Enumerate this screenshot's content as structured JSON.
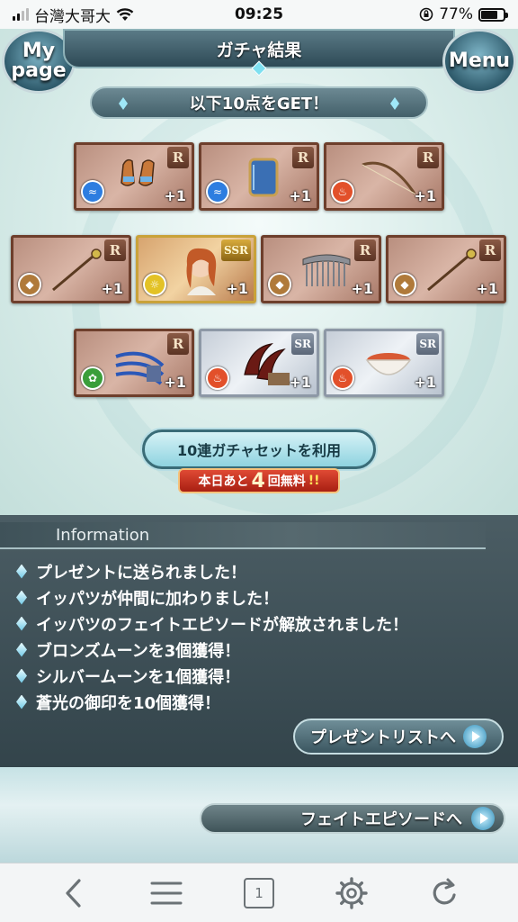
{
  "status": {
    "carrier": "台灣大哥大",
    "time": "09:25",
    "battery": "77%",
    "battery_level": 0.77
  },
  "header": {
    "title": "ガチャ結果",
    "mypage_label": "My page",
    "menu_label": "Menu"
  },
  "banner": {
    "text": "以下10点をGET！"
  },
  "items": [
    {
      "rarity": "R",
      "element": "water",
      "qty": "+1",
      "art": "gauntlets"
    },
    {
      "rarity": "R",
      "element": "water",
      "qty": "+1",
      "art": "shield"
    },
    {
      "rarity": "R",
      "element": "fire",
      "qty": "+1",
      "art": "bow"
    },
    {
      "rarity": "R",
      "element": "earth",
      "qty": "+1",
      "art": "staff"
    },
    {
      "rarity": "SSR",
      "element": "light",
      "qty": "+1",
      "art": "character"
    },
    {
      "rarity": "R",
      "element": "earth",
      "qty": "+1",
      "art": "comb"
    },
    {
      "rarity": "R",
      "element": "earth",
      "qty": "+1",
      "art": "staff"
    },
    {
      "rarity": "R",
      "element": "wind",
      "qty": "+1",
      "art": "claw"
    },
    {
      "rarity": "SR",
      "element": "fire",
      "qty": "+1",
      "art": "talons"
    },
    {
      "rarity": "SR",
      "element": "fire",
      "qty": "+1",
      "art": "bowl"
    }
  ],
  "colors": {
    "water": "#2d7de0",
    "fire": "#e2502a",
    "earth": "#b07a3a",
    "light": "#e3c226",
    "wind": "#3a9e3a"
  },
  "actions": {
    "set_button": "10連ガチャセットを利用",
    "free_prefix": "本日あと",
    "free_count": "4",
    "free_suffix": "回無料",
    "free_exclaim": "!!"
  },
  "information": {
    "title": "Information",
    "messages": [
      "プレゼントに送られました！",
      "イッパツが仲間に加わりました！",
      "イッパツのフェイトエピソードが解放されました！",
      "ブロンズムーンを3個獲得！",
      "シルバームーンを1個獲得！",
      "蒼光の御印を10個獲得！"
    ],
    "present_list_button": "プレゼントリストへ"
  },
  "fate_button": "フェイトエピソードへ",
  "toolbar": {
    "tab_count": "1"
  }
}
